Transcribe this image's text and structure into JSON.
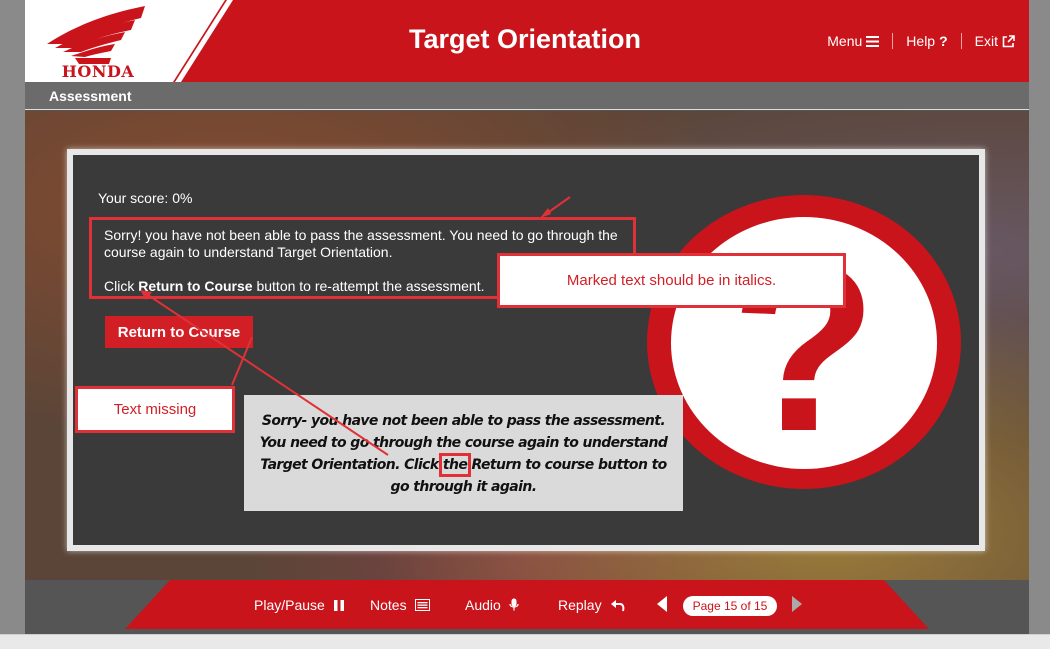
{
  "header": {
    "logo_text": "HONDA",
    "title": "Target Orientation",
    "nav": {
      "menu": "Menu",
      "help": "Help",
      "exit": "Exit"
    }
  },
  "section": {
    "label": "Assessment"
  },
  "content": {
    "score": "Your score: 0%",
    "message_line1": "Sorry! you have not been able to pass the assessment. You need to go through the course again to understand Target Orientation.",
    "message_pre": "Click ",
    "message_bold": "Return to Course",
    "message_post": " button to re-attempt the assessment.",
    "return_button": "Return to Course"
  },
  "review": {
    "note_italics": "Marked text should be in italics.",
    "note_missing": "Text missing",
    "correction_pre": "Sorry- you have not been able to pass the assessment. You need to go through the course again to understand Target Orientation. Click ",
    "correction_marked": "the",
    "correction_post": " Return to course button to go through it again."
  },
  "footer": {
    "play_pause": "Play/Pause",
    "notes": "Notes",
    "audio": "Audio",
    "replay": "Replay",
    "page": "Page 15 of 15"
  },
  "colors": {
    "brand_red": "#c9141c",
    "annotation_red": "#e03138"
  }
}
